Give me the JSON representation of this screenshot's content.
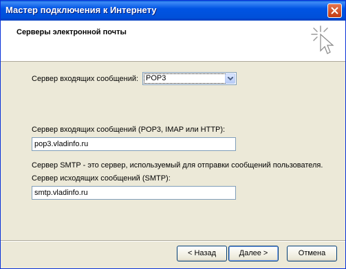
{
  "window": {
    "title": "Мастер подключения к Интернету"
  },
  "header": {
    "title": "Серверы электронной почты"
  },
  "incoming_type": {
    "label": "Сервер входящих сообщений:",
    "selected": "POP3"
  },
  "incoming_server": {
    "label": "Сервер входящих сообщений (POP3, IMAP или HTTP):",
    "value": "pop3.vladinfo.ru"
  },
  "smtp_note": "Сервер SMTP - это сервер, используемый для отправки сообщений  пользователя.",
  "outgoing_server": {
    "label": "Сервер исходящих сообщений (SMTP):",
    "value": "smtp.vladinfo.ru"
  },
  "buttons": {
    "back": "< Назад",
    "next": "Далее >",
    "cancel": "Отмена"
  },
  "colors": {
    "titlebar": "#0054e3",
    "face": "#ece9d8",
    "border": "#7f9db9"
  },
  "icons": {
    "close": "close-icon",
    "wizard": "sparkle-cursor-icon",
    "dropdown": "chevron-down-icon"
  }
}
